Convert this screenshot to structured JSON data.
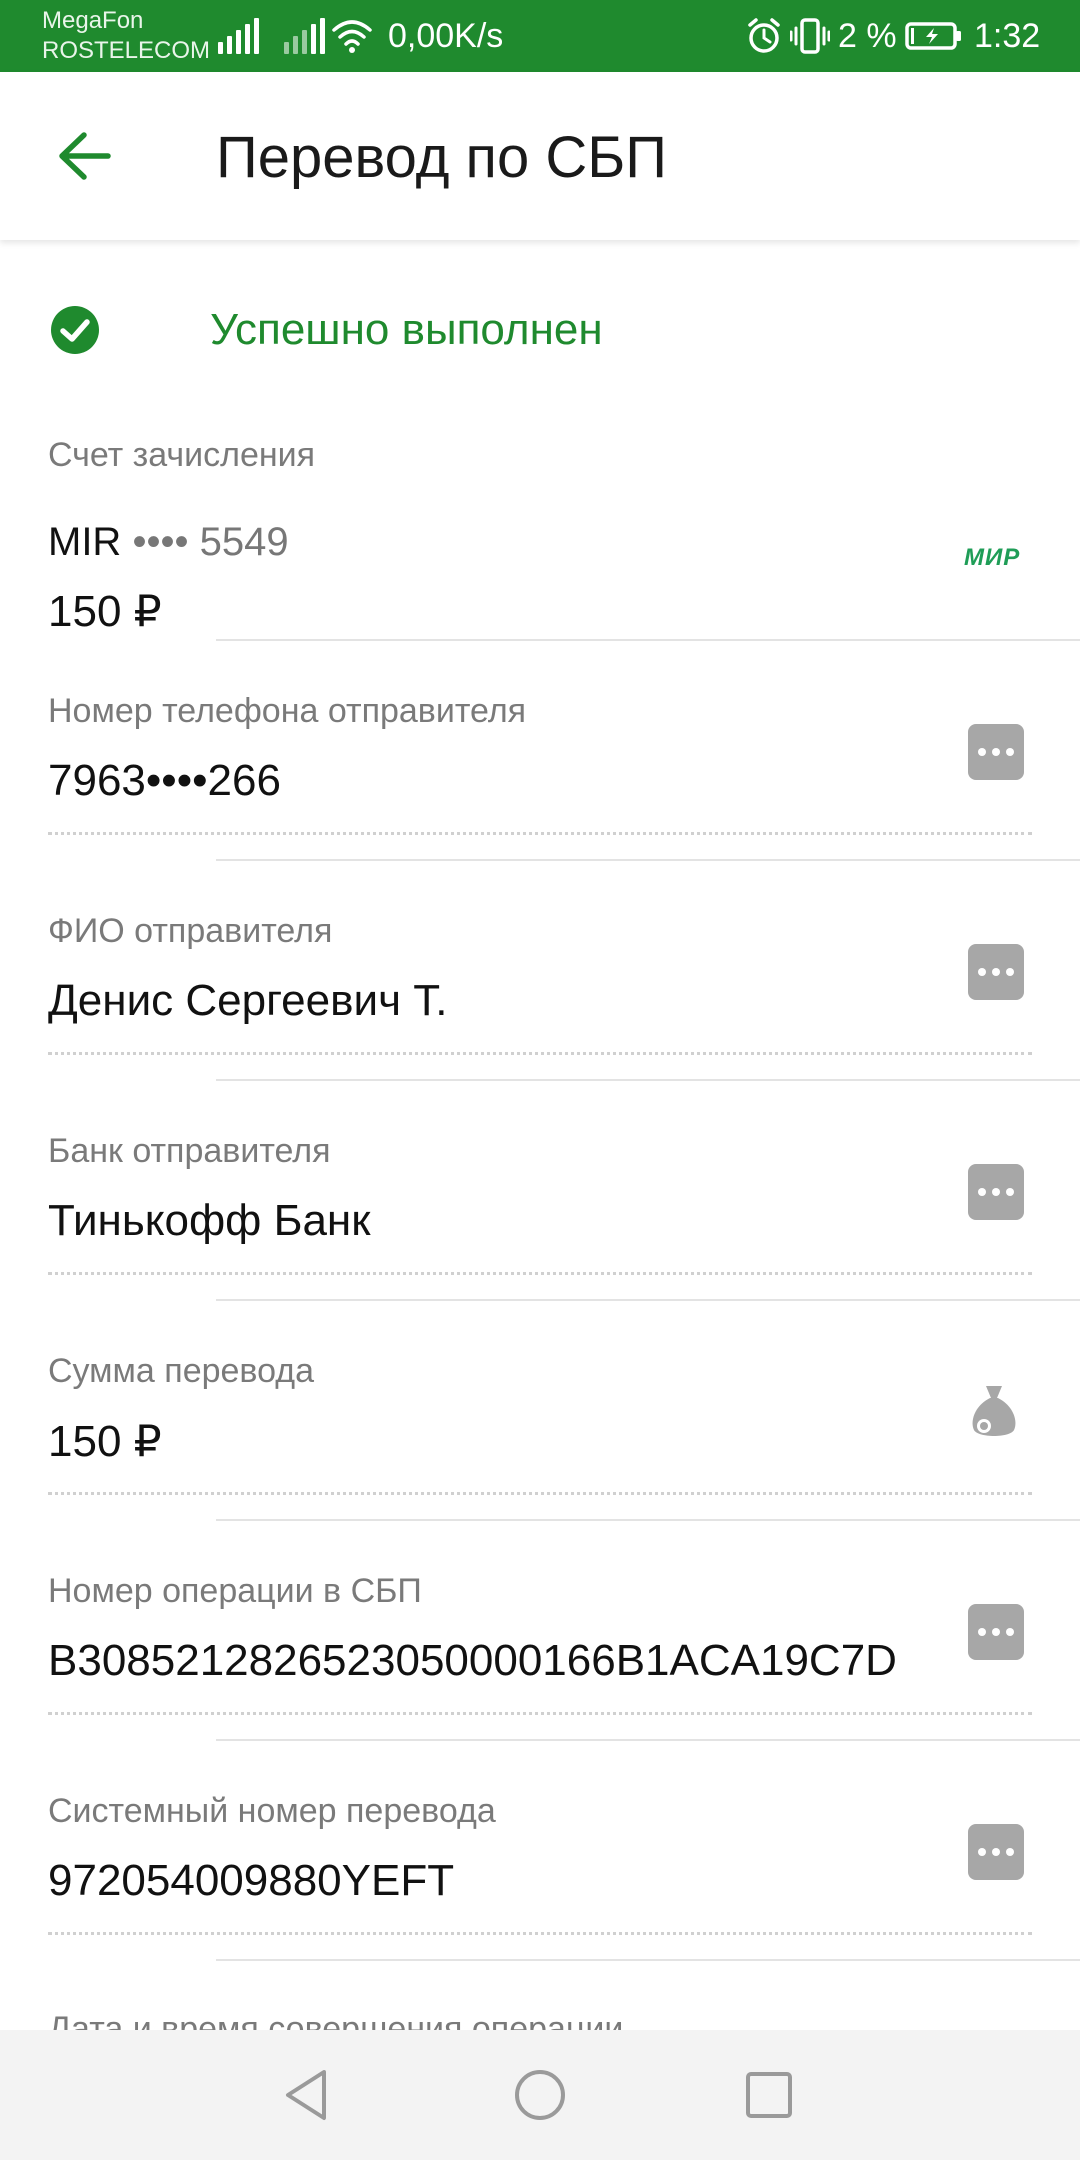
{
  "status_bar": {
    "carrier_1": "MegaFon",
    "carrier_2": "ROSTELECOM",
    "net_speed": "0,00K/s",
    "battery_percent": "2 %",
    "time": "1:32"
  },
  "app_bar": {
    "title": "Перевод по СБП",
    "back_icon": "arrow-left-icon"
  },
  "transfer_status": {
    "text": "Успешно выполнен",
    "color": "#1f8a2e"
  },
  "account": {
    "label": "Счет зачисления",
    "card_system": "MIR",
    "card_mask": "•••• 5549",
    "amount": "150 ₽",
    "logo": "МИР"
  },
  "fields": [
    {
      "label": "Номер телефона отправителя",
      "value": "7963••••266",
      "action_icon": "more-icon"
    },
    {
      "label": "ФИО отправителя",
      "value": "Денис Сергеевич Т.",
      "action_icon": "more-icon"
    },
    {
      "label": "Банк отправителя",
      "value": "Тинькофф Банк",
      "action_icon": "more-icon"
    },
    {
      "label": "Сумма перевода",
      "value": "150 ₽",
      "action_icon": "money-bag-icon"
    },
    {
      "label": "Номер операции в СБП",
      "value": "B3085212826523050000166B1ACA19C7D",
      "action_icon": "more-icon"
    },
    {
      "label": "Системный номер перевода",
      "value": "972054009880YEFT",
      "action_icon": "more-icon"
    }
  ],
  "partial_next_label": "Дата и время совершения операции",
  "colors": {
    "brand_green": "#1f8a2e",
    "icon_gray": "#a7a7a7"
  }
}
